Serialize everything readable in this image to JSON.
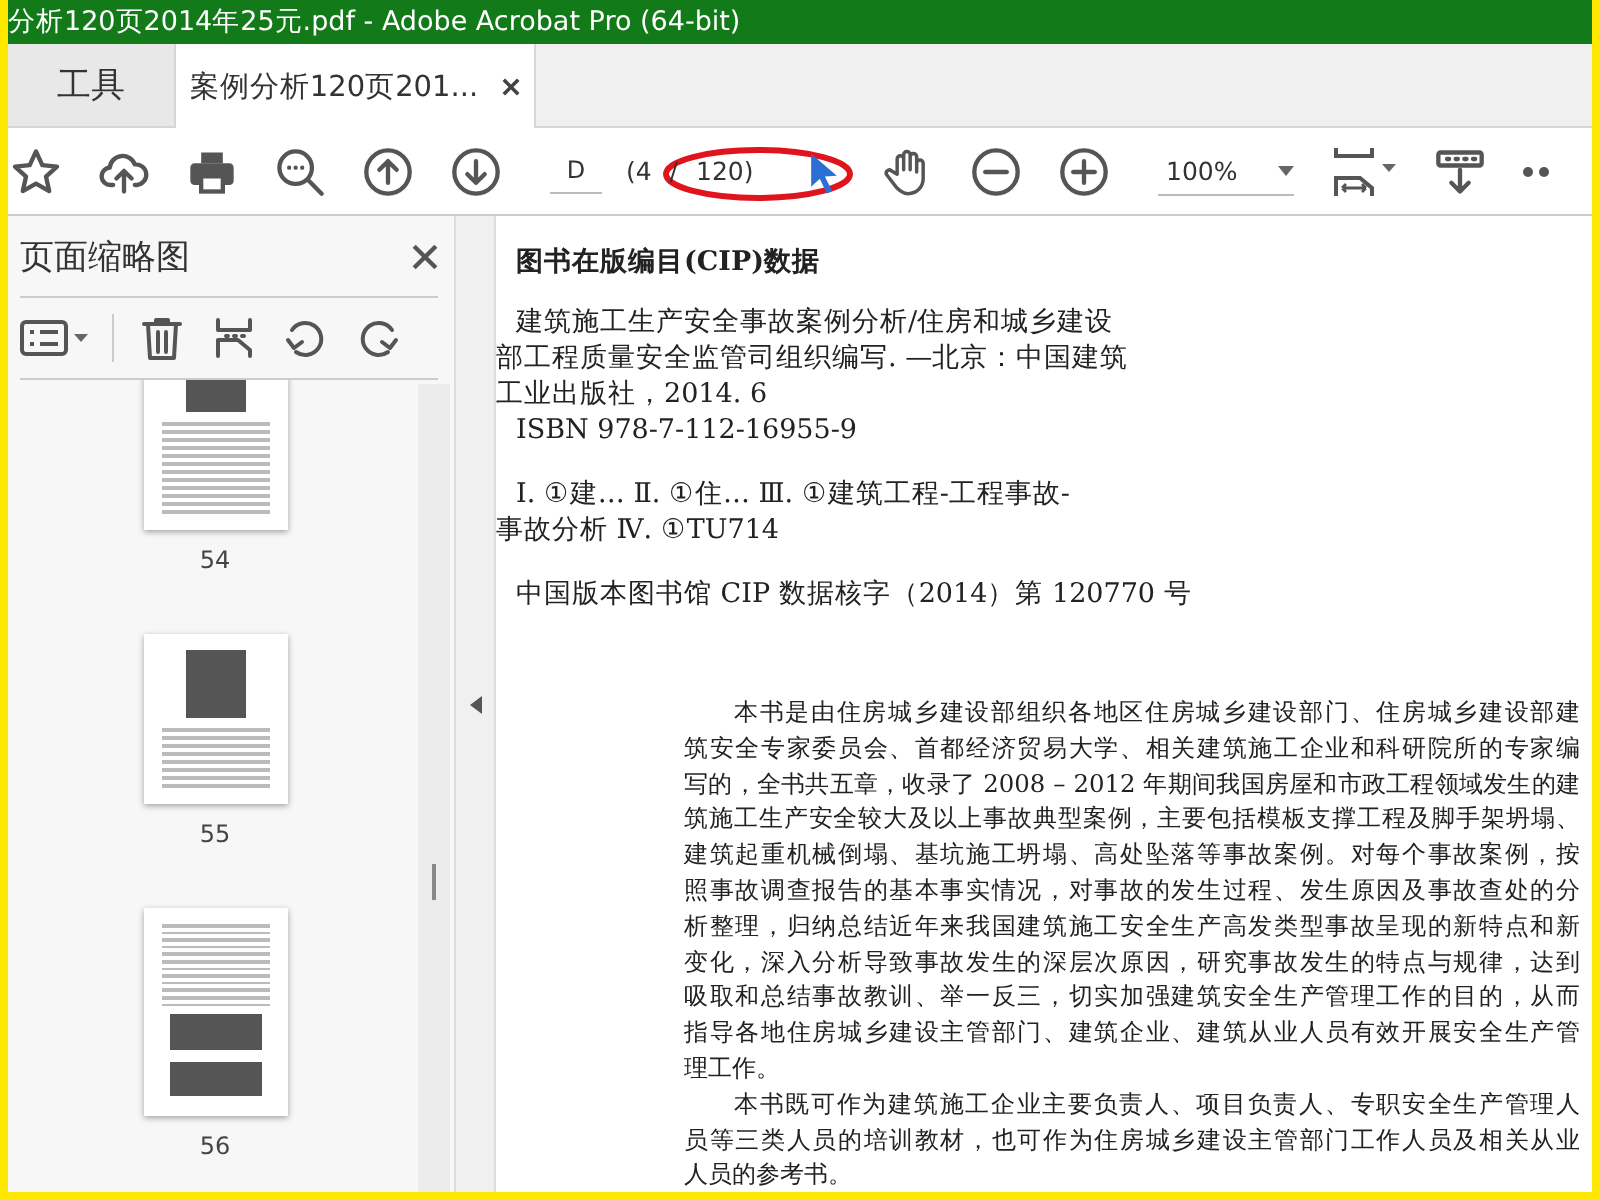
{
  "window": {
    "title": "分析120页2014年25元.pdf - Adobe Acrobat Pro (64-bit)"
  },
  "tabs": [
    {
      "label": "工具",
      "selected": false
    },
    {
      "label": "案例分析120页201...",
      "selected": true
    }
  ],
  "toolbar": {
    "page_field": {
      "value": "D"
    },
    "page_count": "(4 / 120)",
    "zoom": {
      "value": "100%"
    }
  },
  "sidebar": {
    "title": "页面缩略图",
    "thumbnails": [
      {
        "label": "54",
        "selected": false
      },
      {
        "label": "55",
        "selected": false
      },
      {
        "label": "56",
        "selected": false
      }
    ]
  },
  "document": {
    "heading": "图书在版编目(CIP)数据",
    "blocks": [
      {
        "kind": "catalog",
        "lines": [
          "建筑施工生产安全事故案例分析/住房和城乡建设",
          "部工程质量安全监管司组织编写. —北京：中国建筑",
          "工业出版社，2014. 6"
        ]
      },
      {
        "kind": "catalog",
        "lines": [
          "ISBN 978-7-112-16955-9"
        ]
      },
      {
        "kind": "catalog",
        "lines": [
          "Ⅰ. ①建…   Ⅱ. ①住…    Ⅲ. ①建筑工程-工程事故-",
          "事故分析   Ⅳ. ①TU714"
        ]
      },
      {
        "kind": "catalog",
        "lines": [
          "中国版本图书馆 CIP 数据核字（2014）第 120770 号"
        ]
      },
      {
        "kind": "body",
        "lines": [
          "本书是由住房城乡建设部组织各地区住房城乡建设部门、住房城乡建设部建",
          "筑安全专家委员会、首都经济贸易大学、相关建筑施工企业和科研院所的专家编",
          "写的，全书共五章，收录了 2008 – 2012 年期间我国房屋和市政工程领域发生的建",
          "筑施工生产安全较大及以上事故典型案例，主要包括模板支撑工程及脚手架坍塌、",
          "建筑起重机械倒塌、基坑施工坍塌、高处坠落等事故案例。对每个事故案例，按",
          "照事故调查报告的基本事实情况，对事故的发生过程、发生原因及事故查处的分",
          "析整理，归纳总结近年来我国建筑施工安全生产高发类型事故呈现的新特点和新",
          "变化，深入分析导致事故发生的深层次原因，研究事故发生的特点与规律，达到",
          "吸取和总结事故教训、举一反三，切实加强建筑安全生产管理工作的目的，从而",
          "指导各地住房城乡建设主管部门、建筑企业、建筑从业人员有效开展安全生产管",
          "理工作。"
        ]
      },
      {
        "kind": "body",
        "lines": [
          "本书既可作为建筑施工企业主要负责人、项目负责人、专职安全生产管理人",
          "员等三类人员的培训教材，也可作为住房城乡建设主管部门工作人员及相关从业",
          "人员的参考书。"
        ]
      }
    ]
  }
}
